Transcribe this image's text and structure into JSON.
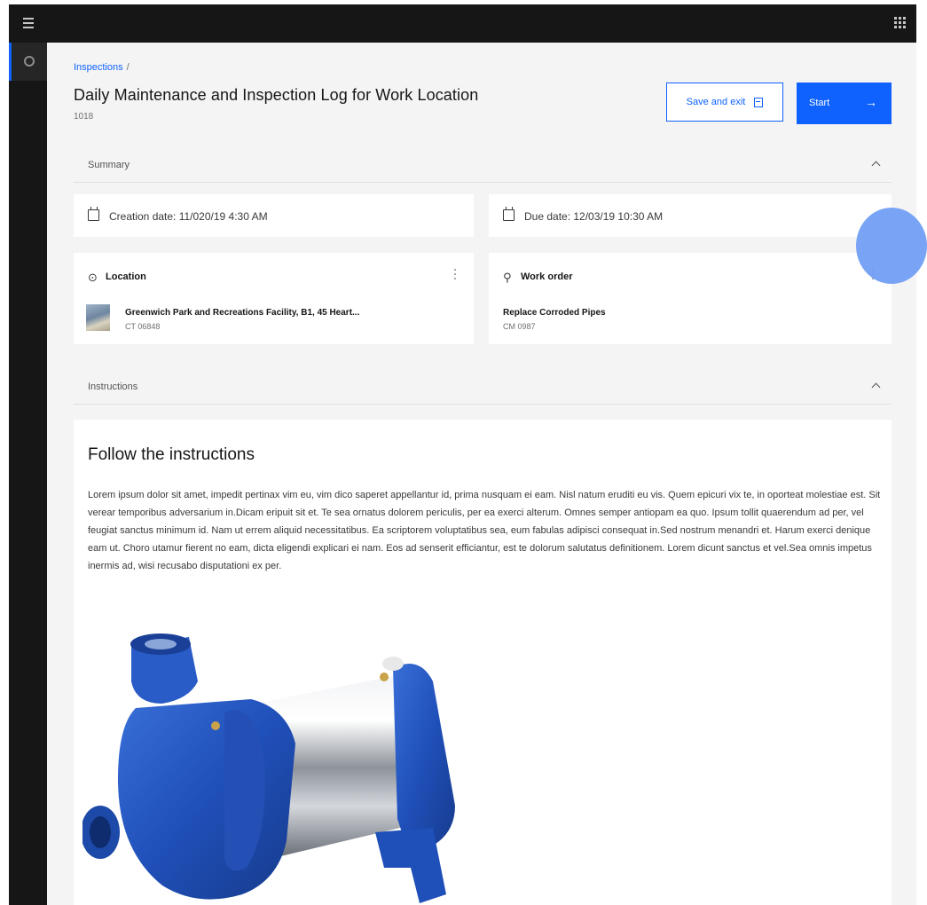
{
  "breadcrumb": {
    "label": "Inspections",
    "separator": "/"
  },
  "page": {
    "title": "Daily Maintenance and Inspection Log for Work Location",
    "id": "1018"
  },
  "actions": {
    "save_label": "Save and exit",
    "start_label": "Start",
    "start_arrow": "→"
  },
  "summary": {
    "label": "Summary",
    "creation_date": "Creation date: 11/020/19  4:30 AM",
    "due_date": "Due date: 12/03/19  10:30 AM",
    "location": {
      "title": "Location",
      "name": "Greenwich Park and Recreations Facility, B1, 45 Heart...",
      "code": "CT 06848"
    },
    "work_order": {
      "title": "Work order",
      "name": "Replace Corroded Pipes",
      "code": "CM 0987"
    }
  },
  "instructions": {
    "label": "Instructions",
    "title": "Follow the instructions",
    "body": "Lorem ipsum dolor sit amet, impedit pertinax vim eu, vim dico saperet appellantur id, prima nusquam ei eam. Nisl natum eruditi eu vis. Quem epicuri vix te, in oporteat molestiae est. Sit verear temporibus adversarium in.Dicam eripuit sit et. Te sea ornatus dolorem periculis, per ea exerci alterum. Omnes semper antiopam ea quo. Ipsum tollit quaerendum ad per, vel feugiat sanctus minimum id. Nam ut errem aliquid necessitatibus. Ea scriptorem voluptatibus sea, eum fabulas adipisci consequat in.Sed nostrum menandri et. Harum exerci denique eam ut. Choro utamur fierent no eam, dicta eligendi explicari ei nam. Eos ad senserit efficiantur, est te dolorum salutatus definitionem. Lorem dicunt sanctus et vel.Sea omnis impetus inermis ad, wisi recusabo disputationi ex per."
  },
  "colors": {
    "primary": "#0f62fe",
    "shell": "#161616",
    "background": "#f4f4f4",
    "touch_indicator": "#6e9cf4"
  }
}
